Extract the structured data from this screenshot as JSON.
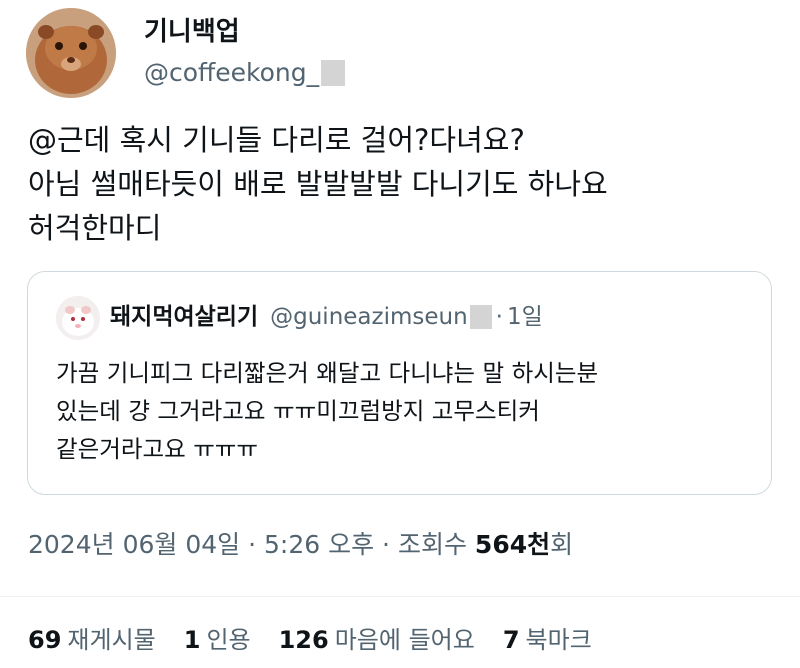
{
  "tweet": {
    "author": {
      "display_name": "기니백업",
      "handle": "@coffeekong_",
      "avatar_icon": "guinea-pig-avatar-icon"
    },
    "text_lines": [
      "@근데 혹시 기니들 다리로 걸어?다녀요?",
      "아님 썰매타듯이 배로 발발발발 다니기도 하나요",
      "허걱한마디"
    ],
    "quote": {
      "author_name": "돼지먹여살리기",
      "handle": "@guineazimseun",
      "separator": "·",
      "time": "1일",
      "avatar_icon": "guinea-pig-avatar-icon",
      "text_lines": [
        "가끔 기니피그 다리짧은거 왜달고 다니냐는 말 하시는분",
        "있는데 걍 그거라고요 ㅠㅠ미끄럼방지 고무스티커",
        "같은거라고요 ㅠㅠㅠ"
      ]
    },
    "meta": {
      "date": "2024년 06월 04일",
      "separator1": "·",
      "time": "5:26 오후",
      "separator2": "·",
      "views_label": "조회수",
      "views_count": "564천",
      "views_suffix": "회"
    },
    "stats": [
      {
        "count": "69",
        "label": "재게시물"
      },
      {
        "count": "1",
        "label": "인용"
      },
      {
        "count": "126",
        "label": "마음에 들어요"
      },
      {
        "count": "7",
        "label": "북마크"
      }
    ]
  }
}
